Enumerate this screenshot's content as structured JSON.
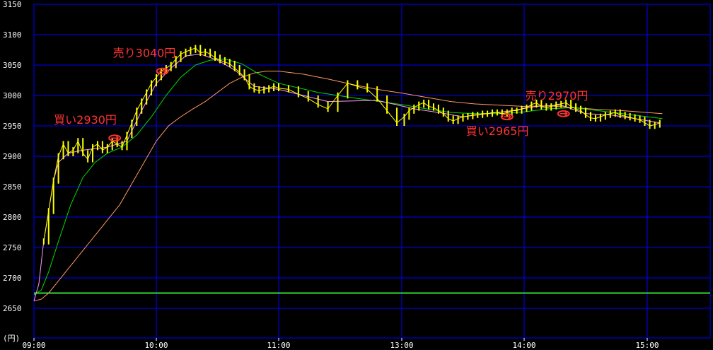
{
  "chart_data": {
    "type": "line",
    "unit_label": "(円)",
    "y_ticks": [
      2650,
      2700,
      2750,
      2800,
      2850,
      2900,
      2950,
      3000,
      3050,
      3100,
      3150
    ],
    "ylim": [
      2610,
      3150
    ],
    "x_ticks": [
      "09:00",
      "10:00",
      "11:00",
      "13:00",
      "14:00",
      "15:00"
    ],
    "x_tick_hours": [
      9,
      10,
      11,
      11.5,
      12.5,
      13.5
    ],
    "xlim": [
      9,
      14.0
    ],
    "grid": true,
    "colors": {
      "price": "#ffff00",
      "ma_short": "#ff99ff",
      "ma_mid": "#00dd00",
      "ma_long": "#ff9966",
      "baseline": "#33dd33",
      "grid": "#0000ff",
      "annotation": "#ff3333"
    },
    "baseline_value": 2675,
    "price_series": [
      [
        9.08,
        2760
      ],
      [
        9.12,
        2810
      ],
      [
        9.16,
        2860
      ],
      [
        9.2,
        2900
      ],
      [
        9.24,
        2920
      ],
      [
        9.28,
        2905
      ],
      [
        9.32,
        2910
      ],
      [
        9.36,
        2925
      ],
      [
        9.4,
        2905
      ],
      [
        9.44,
        2895
      ],
      [
        9.48,
        2915
      ],
      [
        9.52,
        2920
      ],
      [
        9.56,
        2910
      ],
      [
        9.6,
        2915
      ],
      [
        9.64,
        2925
      ],
      [
        9.68,
        2920
      ],
      [
        9.72,
        2915
      ],
      [
        9.76,
        2935
      ],
      [
        9.8,
        2955
      ],
      [
        9.84,
        2975
      ],
      [
        9.88,
        2990
      ],
      [
        9.92,
        3005
      ],
      [
        9.96,
        3020
      ],
      [
        10.0,
        3030
      ],
      [
        10.04,
        3040
      ],
      [
        10.08,
        3045
      ],
      [
        10.12,
        3050
      ],
      [
        10.16,
        3060
      ],
      [
        10.2,
        3068
      ],
      [
        10.24,
        3072
      ],
      [
        10.28,
        3075
      ],
      [
        10.32,
        3078
      ],
      [
        10.36,
        3070
      ],
      [
        10.4,
        3072
      ],
      [
        10.44,
        3068
      ],
      [
        10.48,
        3062
      ],
      [
        10.52,
        3058
      ],
      [
        10.56,
        3055
      ],
      [
        10.6,
        3052
      ],
      [
        10.64,
        3045
      ],
      [
        10.68,
        3038
      ],
      [
        10.72,
        3030
      ],
      [
        10.76,
        3015
      ],
      [
        10.8,
        3010
      ],
      [
        10.84,
        3008
      ],
      [
        10.88,
        3010
      ],
      [
        10.92,
        3012
      ],
      [
        10.96,
        3015
      ],
      [
        11.0,
        3012
      ],
      [
        11.04,
        3010
      ],
      [
        11.08,
        3002
      ],
      [
        11.12,
        2995
      ],
      [
        11.16,
        2985
      ],
      [
        11.2,
        2978
      ],
      [
        11.24,
        3000
      ],
      [
        11.28,
        3020
      ],
      [
        11.32,
        3015
      ],
      [
        11.36,
        3010
      ],
      [
        11.4,
        2995
      ],
      [
        11.44,
        2975
      ],
      [
        11.48,
        2955
      ],
      [
        11.52,
        2965
      ],
      [
        11.56,
        2975
      ],
      [
        11.6,
        2980
      ],
      [
        11.64,
        2985
      ],
      [
        11.68,
        2988
      ],
      [
        11.72,
        2982
      ],
      [
        11.76,
        2980
      ],
      [
        11.8,
        2975
      ],
      [
        11.84,
        2970
      ],
      [
        11.88,
        2962
      ],
      [
        11.92,
        2958
      ],
      [
        11.96,
        2962
      ],
      [
        12.0,
        2965
      ],
      [
        12.04,
        2966
      ],
      [
        12.08,
        2968
      ],
      [
        12.12,
        2968
      ],
      [
        12.16,
        2970
      ],
      [
        12.2,
        2970
      ],
      [
        12.24,
        2972
      ],
      [
        12.28,
        2972
      ],
      [
        12.32,
        2970
      ],
      [
        12.36,
        2972
      ],
      [
        12.4,
        2975
      ],
      [
        12.44,
        2975
      ],
      [
        12.48,
        2978
      ],
      [
        12.52,
        2980
      ],
      [
        12.56,
        2985
      ],
      [
        12.6,
        2988
      ],
      [
        12.64,
        2982
      ],
      [
        12.68,
        2980
      ],
      [
        12.72,
        2982
      ],
      [
        12.76,
        2985
      ],
      [
        12.8,
        2986
      ],
      [
        12.84,
        2988
      ],
      [
        12.88,
        2982
      ],
      [
        12.92,
        2978
      ],
      [
        12.96,
        2975
      ],
      [
        13.0,
        2968
      ],
      [
        13.04,
        2963
      ],
      [
        13.08,
        2962
      ],
      [
        13.12,
        2965
      ],
      [
        13.16,
        2968
      ],
      [
        13.2,
        2970
      ],
      [
        13.24,
        2972
      ],
      [
        13.28,
        2968
      ],
      [
        13.32,
        2966
      ],
      [
        13.36,
        2964
      ],
      [
        13.4,
        2962
      ],
      [
        13.44,
        2960
      ],
      [
        13.48,
        2955
      ],
      [
        13.52,
        2950
      ],
      [
        13.56,
        2952
      ],
      [
        13.6,
        2955
      ]
    ],
    "ma_short_series": [
      [
        9.0,
        2662
      ],
      [
        9.04,
        2690
      ],
      [
        9.08,
        2760
      ],
      [
        9.12,
        2810
      ],
      [
        9.16,
        2860
      ],
      [
        9.2,
        2890
      ],
      [
        9.28,
        2905
      ],
      [
        9.4,
        2910
      ],
      [
        9.6,
        2915
      ],
      [
        9.76,
        2925
      ],
      [
        9.88,
        2975
      ],
      [
        10.0,
        3020
      ],
      [
        10.12,
        3045
      ],
      [
        10.24,
        3065
      ],
      [
        10.36,
        3068
      ],
      [
        10.5,
        3058
      ],
      [
        10.64,
        3042
      ],
      [
        10.8,
        3015
      ],
      [
        11.0,
        3010
      ],
      [
        11.2,
        2990
      ],
      [
        11.4,
        2992
      ],
      [
        11.6,
        2978
      ],
      [
        11.8,
        2972
      ],
      [
        12.0,
        2965
      ],
      [
        12.2,
        2970
      ],
      [
        12.4,
        2975
      ],
      [
        12.6,
        2982
      ],
      [
        12.8,
        2984
      ],
      [
        13.0,
        2970
      ],
      [
        13.2,
        2968
      ],
      [
        13.4,
        2962
      ],
      [
        13.6,
        2955
      ]
    ],
    "ma_mid_series": [
      [
        9.0,
        2672
      ],
      [
        9.06,
        2680
      ],
      [
        9.12,
        2710
      ],
      [
        9.2,
        2760
      ],
      [
        9.3,
        2820
      ],
      [
        9.4,
        2865
      ],
      [
        9.5,
        2890
      ],
      [
        9.6,
        2905
      ],
      [
        9.72,
        2915
      ],
      [
        9.84,
        2935
      ],
      [
        9.96,
        2965
      ],
      [
        10.08,
        3000
      ],
      [
        10.2,
        3030
      ],
      [
        10.32,
        3050
      ],
      [
        10.44,
        3058
      ],
      [
        10.56,
        3060
      ],
      [
        10.7,
        3052
      ],
      [
        10.84,
        3035
      ],
      [
        11.0,
        3020
      ],
      [
        11.16,
        3005
      ],
      [
        11.32,
        2995
      ],
      [
        11.5,
        2985
      ],
      [
        11.7,
        2978
      ],
      [
        11.9,
        2972
      ],
      [
        12.1,
        2970
      ],
      [
        12.3,
        2970
      ],
      [
        12.5,
        2973
      ],
      [
        12.7,
        2978
      ],
      [
        12.9,
        2980
      ],
      [
        13.1,
        2975
      ],
      [
        13.3,
        2970
      ],
      [
        13.5,
        2965
      ],
      [
        13.62,
        2962
      ]
    ],
    "ma_long_series": [
      [
        9.0,
        2662
      ],
      [
        9.06,
        2665
      ],
      [
        9.12,
        2675
      ],
      [
        9.2,
        2695
      ],
      [
        9.3,
        2720
      ],
      [
        9.4,
        2745
      ],
      [
        9.5,
        2770
      ],
      [
        9.6,
        2795
      ],
      [
        9.7,
        2820
      ],
      [
        9.8,
        2855
      ],
      [
        9.9,
        2890
      ],
      [
        10.0,
        2925
      ],
      [
        10.1,
        2950
      ],
      [
        10.2,
        2965
      ],
      [
        10.3,
        2978
      ],
      [
        10.4,
        2990
      ],
      [
        10.5,
        3005
      ],
      [
        10.6,
        3020
      ],
      [
        10.7,
        3030
      ],
      [
        10.8,
        3037
      ],
      [
        10.9,
        3040
      ],
      [
        11.0,
        3040
      ],
      [
        11.1,
        3035
      ],
      [
        11.2,
        3027
      ],
      [
        11.3,
        3018
      ],
      [
        11.4,
        3010
      ],
      [
        11.5,
        3004
      ],
      [
        11.7,
        2997
      ],
      [
        11.9,
        2990
      ],
      [
        12.1,
        2986
      ],
      [
        12.3,
        2984
      ],
      [
        12.5,
        2982
      ],
      [
        12.7,
        2983
      ],
      [
        12.9,
        2980
      ],
      [
        13.1,
        2977
      ],
      [
        13.3,
        2975
      ],
      [
        13.5,
        2972
      ],
      [
        13.62,
        2970
      ]
    ],
    "annotations": [
      {
        "text": "買い2930円",
        "x": 9.66,
        "y": 2930,
        "side": "buy"
      },
      {
        "text": "売り3040円",
        "x": 10.05,
        "y": 3040,
        "side": "sell"
      },
      {
        "text": "買い2965円",
        "x": 12.36,
        "y": 2965,
        "side": "buy"
      },
      {
        "text": "売り2970円",
        "x": 12.82,
        "y": 2970,
        "side": "sell"
      }
    ]
  }
}
